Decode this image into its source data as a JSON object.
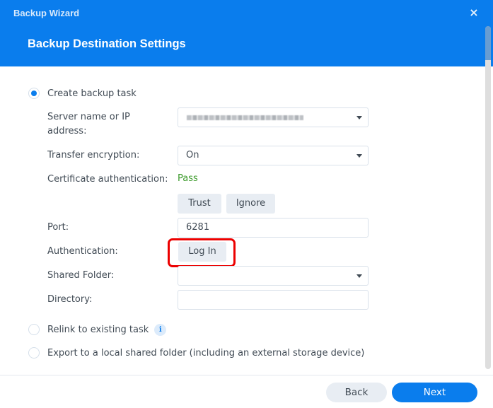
{
  "window": {
    "title": "Backup Wizard",
    "close_icon": "×"
  },
  "header": {
    "title": "Backup Destination Settings"
  },
  "options": {
    "create_task": {
      "label": "Create backup task",
      "selected": true
    },
    "relink_task": {
      "label": "Relink to existing task",
      "selected": false,
      "info_icon": "i"
    },
    "export_local": {
      "label": "Export to a local shared folder (including an external storage device)",
      "selected": false
    }
  },
  "form": {
    "server": {
      "label_line1": "Server name or IP",
      "label_line2": "address:",
      "value": ""
    },
    "encryption": {
      "label": "Transfer encryption:",
      "value": "On"
    },
    "certificate": {
      "label": "Certificate authentication:",
      "status": "Pass",
      "status_color": "#3b9a2a"
    },
    "cert_buttons": {
      "trust": "Trust",
      "ignore": "Ignore"
    },
    "port": {
      "label": "Port:",
      "value": "6281"
    },
    "authentication": {
      "label": "Authentication:",
      "button": "Log In"
    },
    "shared_folder": {
      "label": "Shared Folder:",
      "value": ""
    },
    "directory": {
      "label": "Directory:",
      "value": ""
    }
  },
  "footer": {
    "back": "Back",
    "next": "Next"
  },
  "colors": {
    "accent": "#0a7ded",
    "highlight": "#ec0000"
  }
}
